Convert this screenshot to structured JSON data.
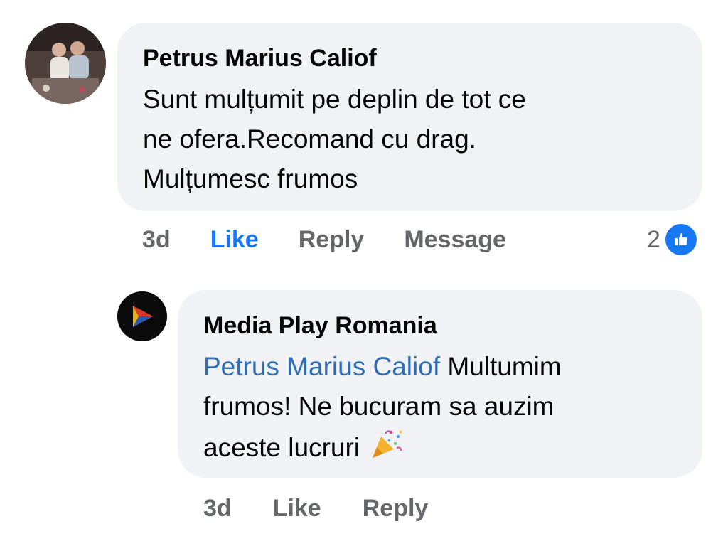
{
  "comment": {
    "author": "Petrus Marius Caliof",
    "lines": [
      "Sunt mulțumit pe deplin de tot ce",
      "ne ofera.Recomand cu drag.",
      "Mulțumesc frumos"
    ],
    "time": "3d",
    "like_label": "Like",
    "reply_label": "Reply",
    "message_label": "Message",
    "reaction_count": "2",
    "reaction_icon": "thumbs-up-icon",
    "like_color": "#1877f2"
  },
  "reply": {
    "author": "Media Play Romania",
    "mention": "Petrus Marius Caliof",
    "line1_rest": " Multumim",
    "line2": "frumos! Ne bucuram sa auzim",
    "line3": "aceste lucruri ",
    "emoji": "party-popper-icon",
    "time": "3d",
    "like_label": "Like",
    "reply_label": "Reply"
  }
}
